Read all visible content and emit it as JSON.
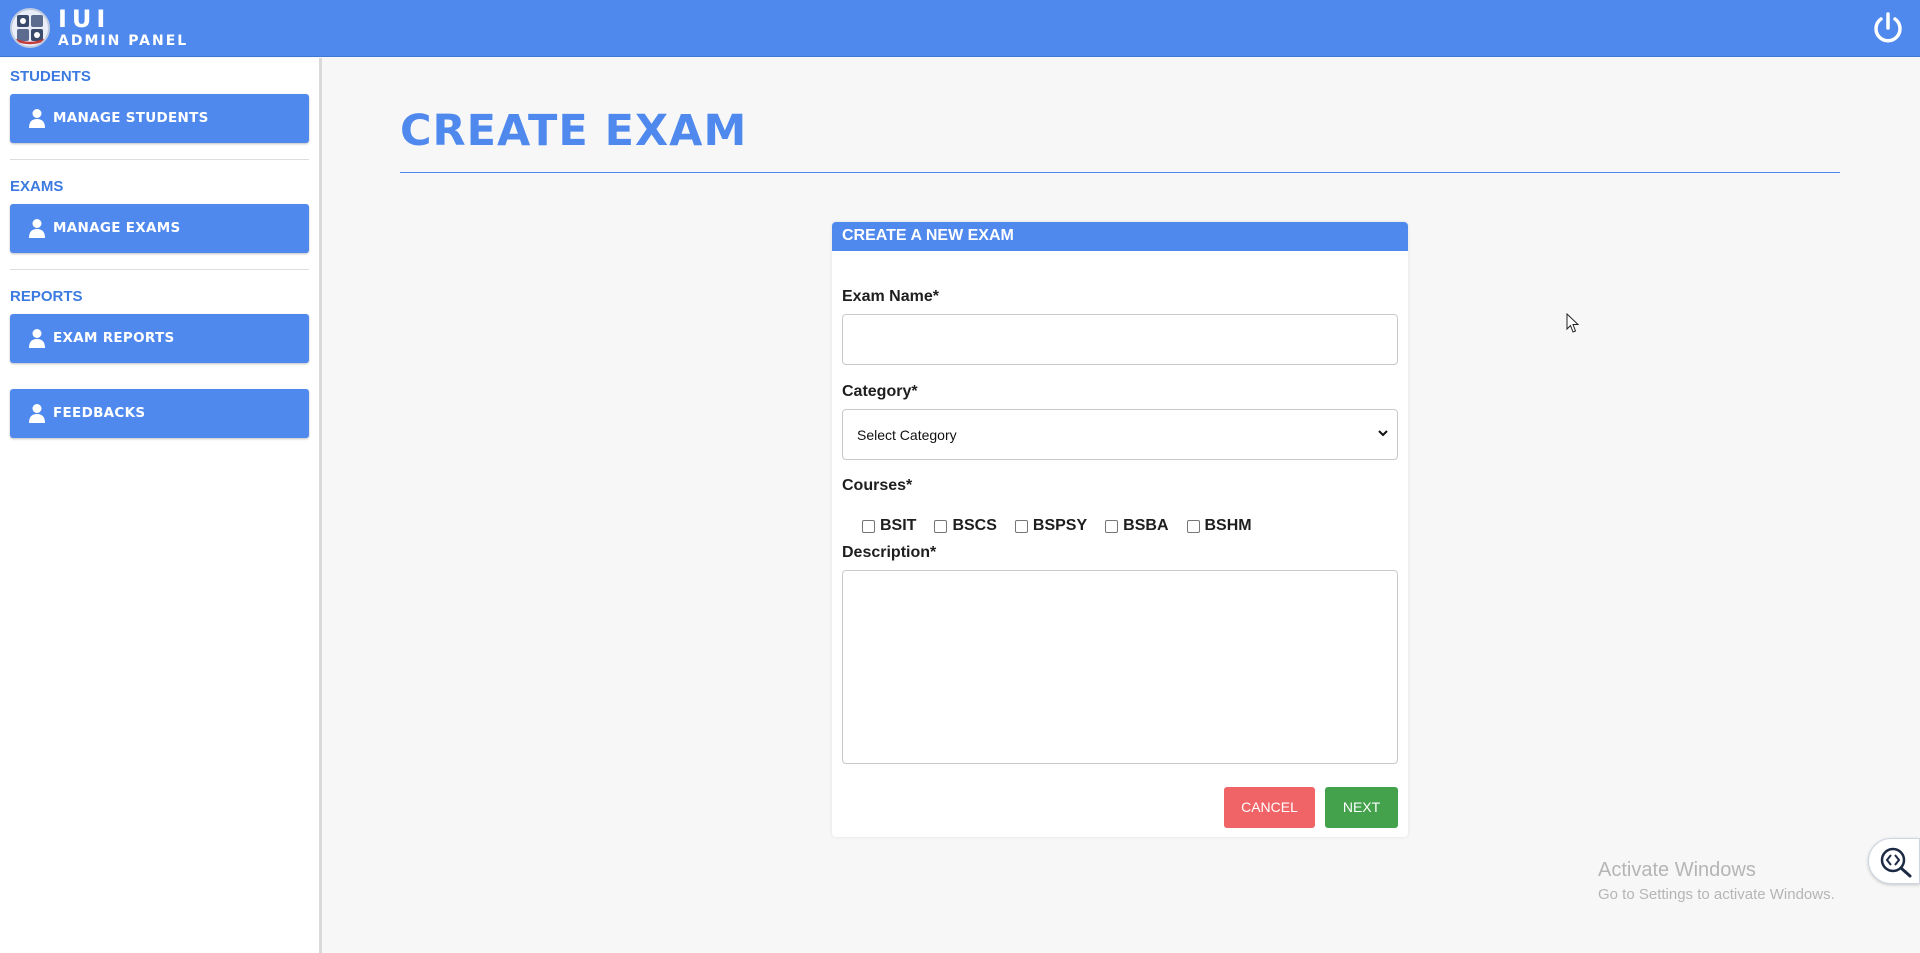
{
  "header": {
    "title": "IUI",
    "subtitle": "ADMIN PANEL",
    "logo_icon": "university-logo-icon",
    "logout_icon": "power-icon"
  },
  "sidebar": {
    "sections": [
      {
        "label": "STUDENTS",
        "items": [
          {
            "label": "MANAGE STUDENTS",
            "icon": "user-icon"
          }
        ]
      },
      {
        "label": "EXAMS",
        "items": [
          {
            "label": "MANAGE EXAMS",
            "icon": "user-icon"
          }
        ]
      },
      {
        "label": "REPORTS",
        "items": [
          {
            "label": "EXAM REPORTS",
            "icon": "user-icon"
          },
          {
            "label": "FEEDBACKS",
            "icon": "user-icon"
          }
        ]
      }
    ]
  },
  "main": {
    "page_title": "CREATE EXAM",
    "form": {
      "heading": "CREATE A NEW EXAM",
      "exam_name_label": "Exam Name*",
      "exam_name_value": "",
      "category_label": "Category*",
      "category_selected": "Select Category",
      "courses_label": "Courses*",
      "courses": [
        {
          "label": "BSIT",
          "checked": false
        },
        {
          "label": "BSCS",
          "checked": false
        },
        {
          "label": "BSPSY",
          "checked": false
        },
        {
          "label": "BSBA",
          "checked": false
        },
        {
          "label": "BSHM",
          "checked": false
        }
      ],
      "description_label": "Description*",
      "description_value": "",
      "cancel_label": "CANCEL",
      "next_label": "NEXT"
    }
  },
  "colors": {
    "primary": "#4f89ee",
    "cancel": "#f06467",
    "next": "#45a24c",
    "background": "#f7f7f7"
  },
  "watermark": {
    "line1": "Activate Windows",
    "line2": "Go to Settings to activate Windows."
  }
}
